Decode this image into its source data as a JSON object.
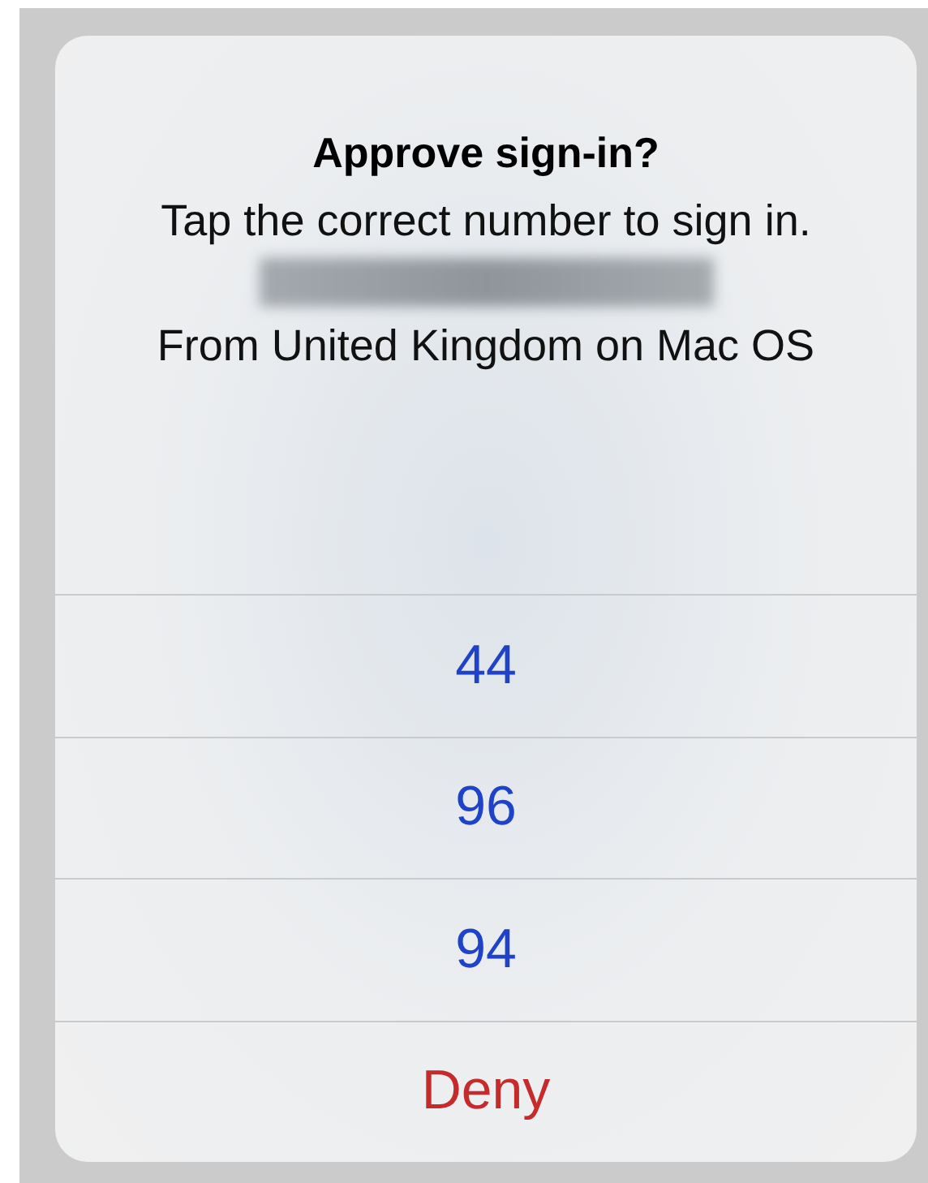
{
  "alert": {
    "title": "Approve sign-in?",
    "message": "Tap the correct number to sign in.",
    "redacted_line": true,
    "detail": "From United Kingdom on Mac OS"
  },
  "actions": [
    {
      "label": "44",
      "kind": "number"
    },
    {
      "label": "96",
      "kind": "number"
    },
    {
      "label": "94",
      "kind": "number"
    },
    {
      "label": "Deny",
      "kind": "destructive"
    }
  ]
}
